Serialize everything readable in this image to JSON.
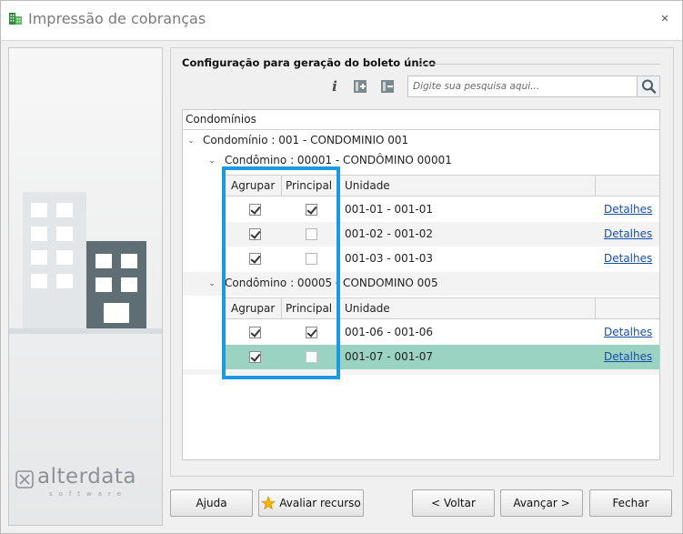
{
  "window": {
    "title": "Impressão de cobranças",
    "close_glyph": "✕"
  },
  "group": {
    "title": "Configuração para geração do boleto único"
  },
  "toolbar": {
    "info_glyph": "i",
    "search_placeholder": "Digite sua pesquisa aqui...",
    "search_value": ""
  },
  "tree": {
    "header": "Condomínios",
    "condominio": {
      "label": "Condomínio : 001 - CONDOMINIO 001",
      "groups": [
        {
          "label": "Condômino : 00001 - CONDÔMINO 00001",
          "columns": [
            "Agrupar",
            "Principal",
            "Unidade"
          ],
          "rows": [
            {
              "agrupar": true,
              "principal": true,
              "unidade": "001-01 - 001-01",
              "link": "Detalhes"
            },
            {
              "agrupar": true,
              "principal": false,
              "unidade": "001-02 - 001-02",
              "link": "Detalhes"
            },
            {
              "agrupar": true,
              "principal": false,
              "unidade": "001-03 - 001-03",
              "link": "Detalhes"
            }
          ]
        },
        {
          "label": "Condômino : 00005 - CONDOMINO 005",
          "columns": [
            "Agrupar",
            "Principal",
            "Unidade"
          ],
          "rows": [
            {
              "agrupar": true,
              "principal": true,
              "unidade": "001-06 - 001-06",
              "link": "Detalhes"
            },
            {
              "agrupar": true,
              "principal": false,
              "unidade": "001-07 - 001-07",
              "link": "Detalhes",
              "selected": true
            }
          ]
        }
      ]
    }
  },
  "brand": {
    "name": "alterdata",
    "tagline": "software"
  },
  "buttons": {
    "help": "Ajuda",
    "rate": "Avaliar recurso",
    "back": "< Voltar",
    "next": "Avançar >",
    "close": "Fechar"
  },
  "colors": {
    "highlight_border": "#1c9ae0",
    "selected_row": "#9bd3c3",
    "link": "#1a4fa8"
  }
}
